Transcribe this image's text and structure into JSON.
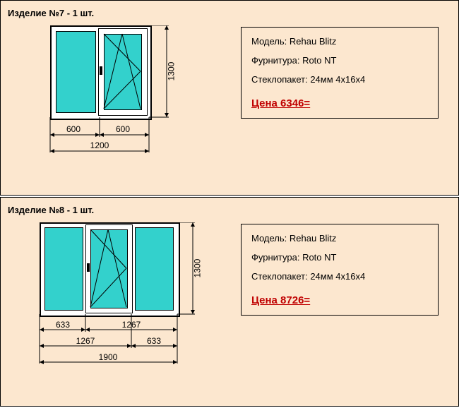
{
  "products": [
    {
      "title": "Изделие №7 - 1 шт.",
      "model_label": "Модель:",
      "model_value": "Rehau Blitz",
      "hardware_label": "Фурнитура:",
      "hardware_value": "Roto NT",
      "glazing_label": "Стеклопакет:",
      "glazing_value": "24мм 4х16х4",
      "price": "Цена 6346=",
      "height": "1300",
      "width_total": "1200",
      "width_left": "600",
      "width_right": "600"
    },
    {
      "title": "Изделие №8 - 1 шт.",
      "model_label": "Модель:",
      "model_value": "Rehau Blitz",
      "hardware_label": "Фурнитура:",
      "hardware_value": "Roto NT",
      "glazing_label": "Стеклопакет:",
      "glazing_value": "24мм 4х16х4",
      "price": "Цена 8726=",
      "height": "1300",
      "width_total": "1900",
      "dim_a": "633",
      "dim_b": "1267",
      "dim_c": "1267",
      "dim_d": "633"
    }
  ]
}
